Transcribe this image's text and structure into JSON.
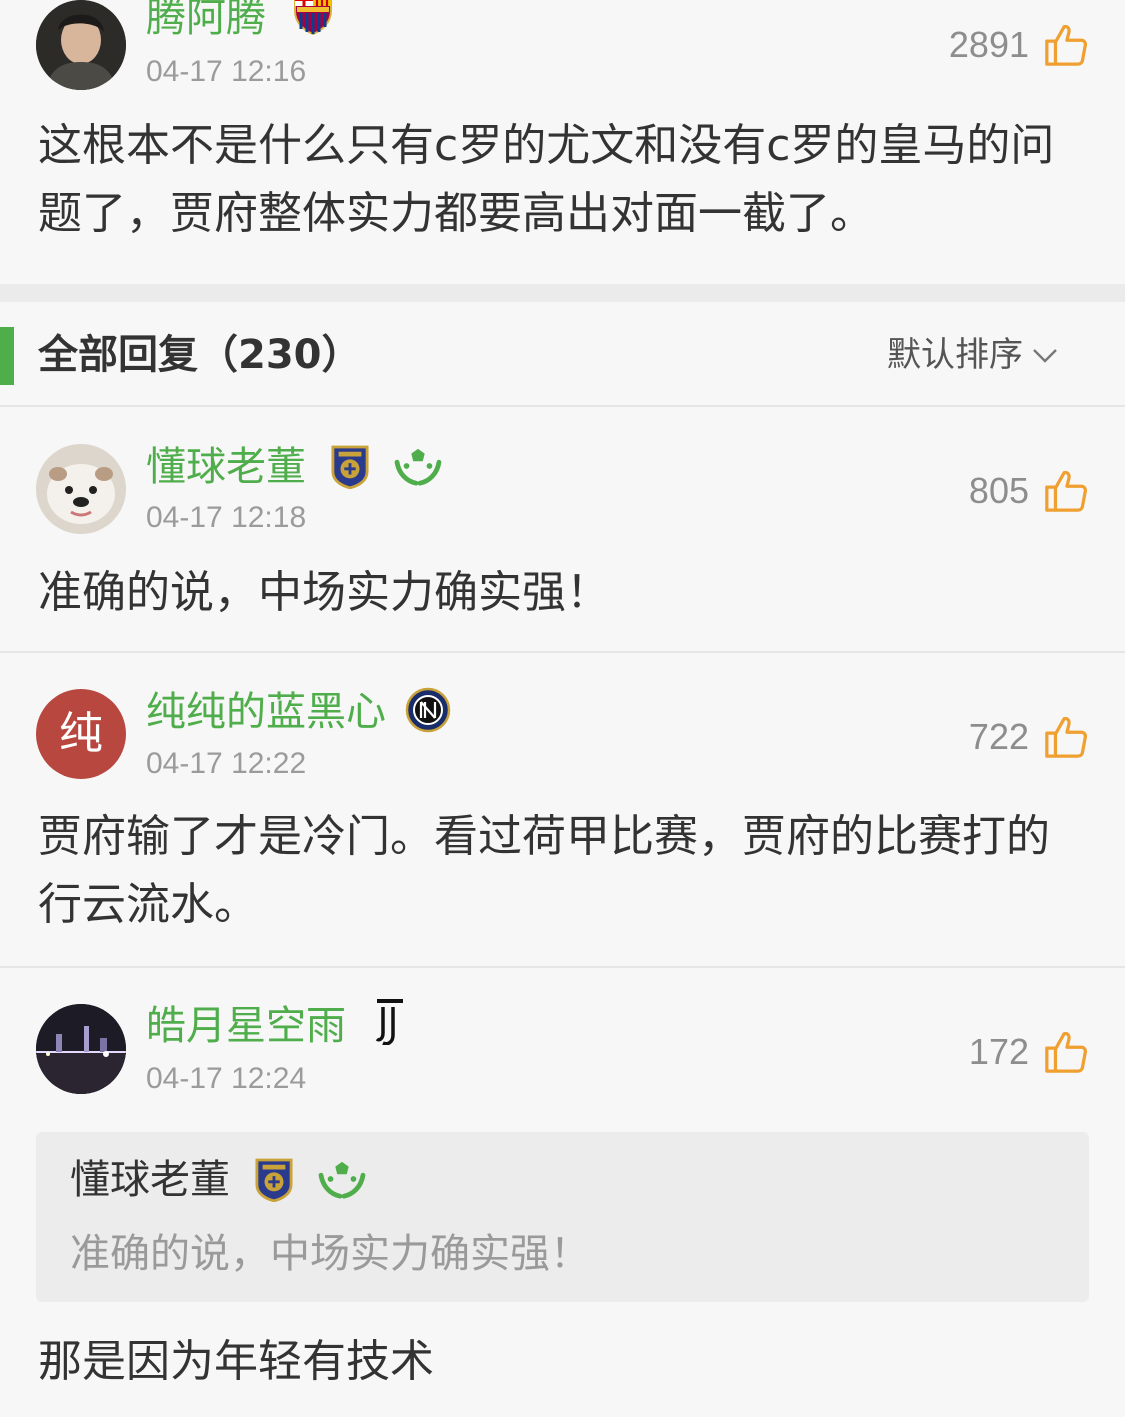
{
  "colors": {
    "accent": "#4fae4b",
    "like": "#f0a030",
    "avatar_chun": "#b8473f"
  },
  "top_comment": {
    "username": "腾阿腾",
    "badge": "fcb-crest-icon",
    "timestamp": "04-17 12:16",
    "likes": "2891",
    "text": "这根本不是什么只有c罗的尤文和没有c罗的皇马的问题了，贾府整体实力都要高出对面一截了。"
  },
  "replies_header": {
    "title": "全部回复（230）",
    "sort_label": "默认排序"
  },
  "replies": [
    {
      "username": "懂球老董",
      "badges": [
        "suning-crest-icon",
        "green-hands-ball-icon"
      ],
      "timestamp": "04-17 12:18",
      "likes": "805",
      "text": "准确的说，中场实力确实强！"
    },
    {
      "username": "纯纯的蓝黑心",
      "avatar_text": "纯",
      "badges": [
        "inter-crest-icon"
      ],
      "timestamp": "04-17 12:22",
      "likes": "722",
      "text": "贾府输了才是冷门。看过荷甲比赛，贾府的比赛打的行云流水。"
    },
    {
      "username": "皓月星空雨",
      "badges": [
        "juventus-logo-icon"
      ],
      "timestamp": "04-17 12:24",
      "likes": "172",
      "quote": {
        "username": "懂球老董",
        "text": "准确的说，中场实力确实强！"
      },
      "text": "那是因为年轻有技术"
    }
  ]
}
